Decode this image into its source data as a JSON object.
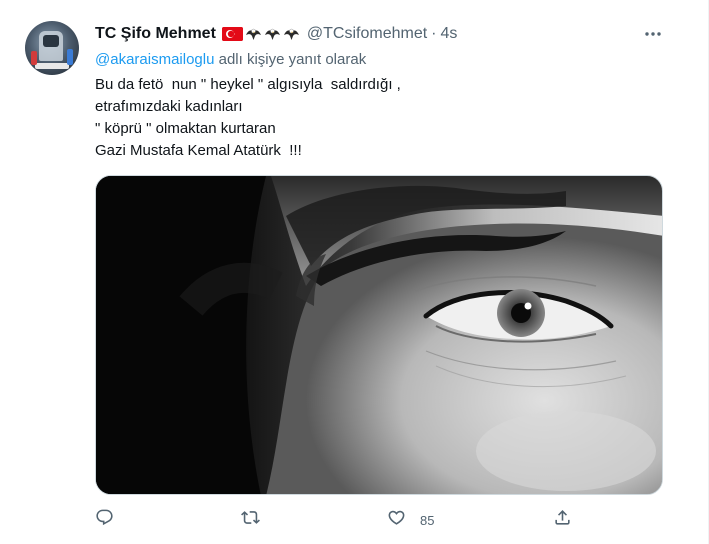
{
  "tweet": {
    "author_name": "TC Şifo Mehmet",
    "author_handle": "@TCsifomehmet",
    "separator": "·",
    "time": "4s",
    "reply_mention": "@akaraismailoglu",
    "reply_suffix": " adlı kişiye yanıt olarak",
    "text_lines": [
      "Bu da fetö  nun \" heykel \" algısıyla  saldırdığı ,",
      "etrafımızdaki kadınları",
      "\" köprü \" olmaktan kurtaran",
      "Gazi Mustafa Kemal Atatürk  !!!"
    ],
    "image_description": "",
    "actions": {
      "reply_count": "",
      "retweet_count": "",
      "like_count": "85",
      "share_count": ""
    }
  },
  "icons": {
    "more": "more-horizontal-icon",
    "reply": "reply-icon",
    "retweet": "retweet-icon",
    "like": "heart-icon",
    "share": "share-icon",
    "flag": "turkey-flag-icon",
    "eagle": "eagle-emoji-icon"
  },
  "colors": {
    "primary_text": "#0f1419",
    "secondary_text": "#536471",
    "link": "#1d9bf0",
    "flag_red": "#e30a17"
  }
}
